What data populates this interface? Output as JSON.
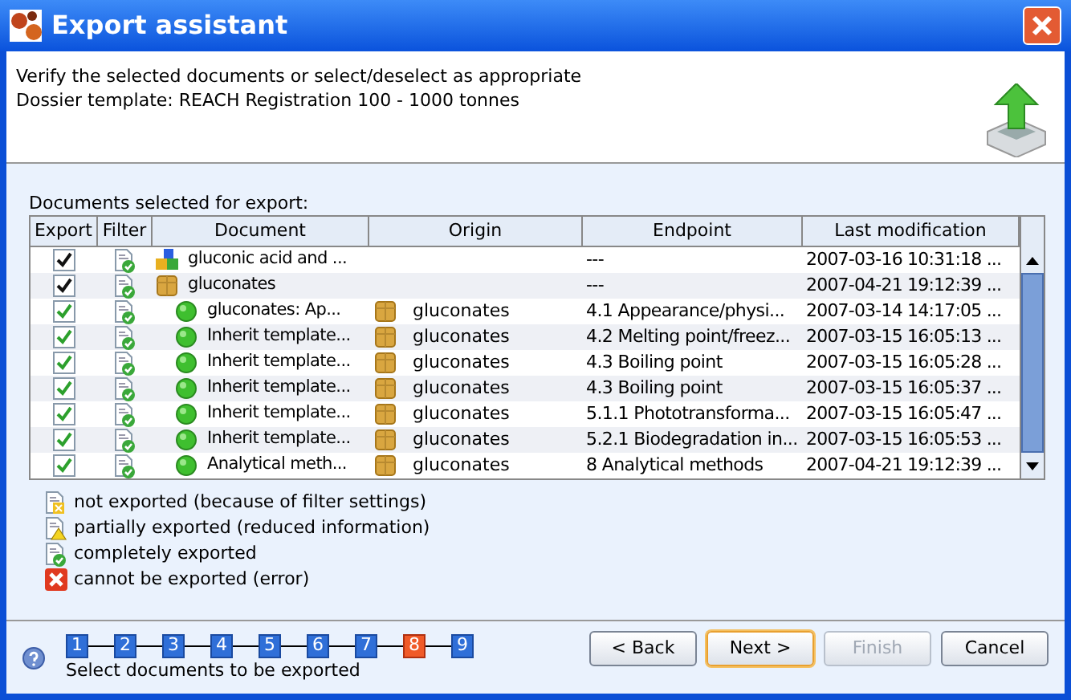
{
  "window": {
    "title": "Export assistant"
  },
  "header": {
    "lines": [
      "Verify the selected documents or select/deselect as appropriate",
      "Dossier template: REACH Registration 100 - 1000 tonnes"
    ]
  },
  "table": {
    "caption": "Documents selected for export:",
    "columns": [
      "Export",
      "Filter",
      "Document",
      "Origin",
      "Endpoint",
      "Last modification"
    ],
    "rows": [
      {
        "kind": "substance",
        "checked": true,
        "document": "gluconic acid and ...",
        "endpoint": "---",
        "modified": "2007-03-16 10:31:18 ..."
      },
      {
        "kind": "dossier",
        "checked": true,
        "document": "gluconates",
        "endpoint": "---",
        "modified": "2007-04-21 19:12:39 ...",
        "children": [
          {
            "kind": "document",
            "checked": true,
            "document": "gluconates: Ap...",
            "origin": "gluconates",
            "endpoint": "4.1 Appearance/physi...",
            "modified": "2007-03-14 14:17:05 ..."
          },
          {
            "kind": "document",
            "checked": true,
            "document": "Inherit template...",
            "origin": "gluconates",
            "endpoint": "4.2 Melting point/freez...",
            "modified": "2007-03-15 16:05:13 ..."
          },
          {
            "kind": "document",
            "checked": true,
            "document": "Inherit template...",
            "origin": "gluconates",
            "endpoint": "4.3 Boiling point",
            "modified": "2007-03-15 16:05:28 ..."
          },
          {
            "kind": "document",
            "checked": true,
            "document": "Inherit template...",
            "origin": "gluconates",
            "endpoint": "4.3 Boiling point",
            "modified": "2007-03-15 16:05:37 ..."
          },
          {
            "kind": "document",
            "checked": true,
            "document": "Inherit template...",
            "origin": "gluconates",
            "endpoint": "5.1.1 Phototransforma...",
            "modified": "2007-03-15 16:05:47 ..."
          },
          {
            "kind": "document",
            "checked": true,
            "document": "Inherit template...",
            "origin": "gluconates",
            "endpoint": "5.2.1 Biodegradation in...",
            "modified": "2007-03-15 16:05:53 ..."
          },
          {
            "kind": "document",
            "checked": true,
            "document": "Analytical meth...",
            "origin": "gluconates",
            "endpoint": "8 Analytical methods",
            "modified": "2007-04-21 19:12:39 ..."
          }
        ]
      }
    ]
  },
  "legend": [
    {
      "kind": "not_exported",
      "label": "not exported (because of filter settings)"
    },
    {
      "kind": "partial",
      "label": "partially exported (reduced information)"
    },
    {
      "kind": "complete",
      "label": "completely exported"
    },
    {
      "kind": "error",
      "label": "cannot be exported (error)"
    }
  ],
  "steps": [
    {
      "label": "1",
      "selected": false
    },
    {
      "label": "2",
      "selected": false
    },
    {
      "label": "3",
      "selected": false
    },
    {
      "label": "4",
      "selected": false
    },
    {
      "label": "5",
      "selected": false
    },
    {
      "label": "6",
      "selected": false
    },
    {
      "label": "7",
      "selected": false
    },
    {
      "label": "8",
      "selected": true
    },
    {
      "label": "9",
      "selected": false
    }
  ],
  "step_caption": "Select documents to be exported",
  "buttons": [
    {
      "label": "< Back",
      "default": false,
      "disabled": false
    },
    {
      "label": "Next >",
      "default": true,
      "disabled": false
    },
    {
      "label": "Finish",
      "default": false,
      "disabled": true
    },
    {
      "label": "Cancel",
      "default": false,
      "disabled": false
    }
  ]
}
